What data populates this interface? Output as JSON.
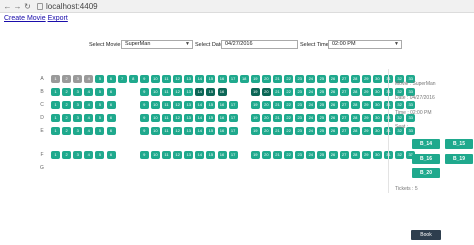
{
  "browser": {
    "back_icon": "back-arrow-icon",
    "forward_icon": "forward-arrow-icon",
    "reload_icon": "reload-icon",
    "url": "localhost:4409"
  },
  "links": {
    "create_movie": "Create Movie",
    "export": "Export"
  },
  "filters": {
    "movie_label": "Select Movie:",
    "movie_value": "SuperMan",
    "date_label": "Select Date",
    "date_value": "04/27/2016",
    "time_label": "Select Time:",
    "time_value": "02:00 PM"
  },
  "rows": [
    {
      "label": "A",
      "blocks": [
        [
          1,
          10
        ],
        [
          11,
          26
        ],
        [
          27,
          33
        ]
      ],
      "booked": [
        1,
        2,
        3,
        4
      ],
      "selected": []
    },
    {
      "label": "B",
      "blocks": [
        [
          1,
          6
        ],
        [
          9,
          16
        ],
        [
          19,
          33
        ]
      ],
      "booked": [],
      "selected": [
        14,
        15,
        16,
        19,
        20
      ]
    },
    {
      "label": "C",
      "blocks": [
        [
          1,
          6
        ],
        [
          9,
          17
        ],
        [
          19,
          33
        ]
      ],
      "booked": [],
      "selected": []
    },
    {
      "label": "D",
      "blocks": [
        [
          1,
          6
        ],
        [
          9,
          17
        ],
        [
          19,
          33
        ]
      ],
      "booked": [],
      "selected": []
    },
    {
      "label": "E",
      "blocks": [
        [
          1,
          6
        ],
        [
          9,
          17
        ],
        [
          19,
          33
        ]
      ],
      "booked": [],
      "selected": []
    },
    {
      "label": "F",
      "blocks": [
        [
          1,
          6
        ],
        [
          9,
          17
        ],
        [
          19,
          33
        ]
      ],
      "booked": [],
      "selected": []
    },
    {
      "label": "G",
      "blocks": [],
      "booked": [],
      "selected": []
    }
  ],
  "summary": {
    "movie": "Movie : SuperMan",
    "date": "Date : 04/27/2016",
    "time": "Time : 02:00 PM",
    "seats_label": "Seat :",
    "seats": [
      "B_14",
      "B_15",
      "B_16",
      "B_19",
      "B_20"
    ],
    "tickets": "Tickets : 5",
    "book_label": "Book"
  }
}
